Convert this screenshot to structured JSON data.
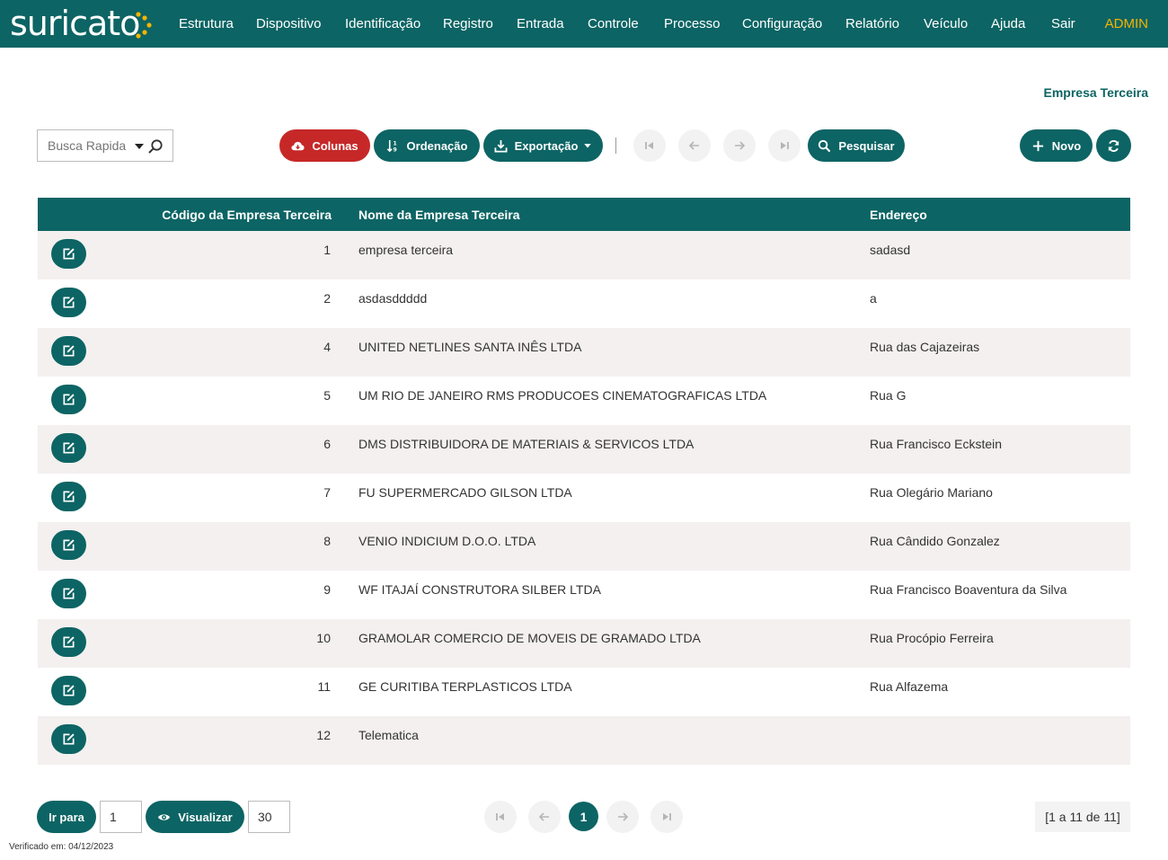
{
  "app": {
    "logo": "suricato"
  },
  "nav": {
    "items": [
      "Estrutura",
      "Dispositivo",
      "Identificação",
      "Registro",
      "Entrada",
      "Controle",
      "Processo",
      "Configuração",
      "Relatório",
      "Veículo",
      "Ajuda",
      "Sair"
    ],
    "user": "ADMIN"
  },
  "page": {
    "title": "Empresa Terceira"
  },
  "toolbar": {
    "quick_search_placeholder": "Busca Rapida",
    "columns": "Colunas",
    "sort": "Ordenação",
    "export": "Exportação",
    "search": "Pesquisar",
    "new": "Novo"
  },
  "table": {
    "headers": [
      "Código da Empresa Terceira",
      "Nome da Empresa Terceira",
      "Endereço"
    ],
    "rows": [
      {
        "code": "1",
        "name": "empresa terceira",
        "address": "sadasd"
      },
      {
        "code": "2",
        "name": "asdasddddd",
        "address": "a"
      },
      {
        "code": "4",
        "name": "UNITED NETLINES SANTA INÊS LTDA",
        "address": "Rua das Cajazeiras"
      },
      {
        "code": "5",
        "name": "UM RIO DE JANEIRO RMS PRODUCOES CINEMATOGRAFICAS LTDA",
        "address": "Rua G"
      },
      {
        "code": "6",
        "name": "DMS DISTRIBUIDORA DE MATERIAIS & SERVICOS LTDA",
        "address": "Rua Francisco Eckstein"
      },
      {
        "code": "7",
        "name": "FU SUPERMERCADO GILSON LTDA",
        "address": "Rua Olegário Mariano"
      },
      {
        "code": "8",
        "name": "VENIO INDICIUM D.O.O. LTDA",
        "address": "Rua Cândido Gonzalez"
      },
      {
        "code": "9",
        "name": "WF ITAJAÍ CONSTRUTORA SILBER LTDA",
        "address": "Rua Francisco Boaventura da Silva"
      },
      {
        "code": "10",
        "name": "GRAMOLAR COMERCIO DE MOVEIS DE GRAMADO LTDA",
        "address": "Rua Procópio Ferreira"
      },
      {
        "code": "11",
        "name": "GE CURITIBA TERPLASTICOS LTDA",
        "address": "Rua Alfazema"
      },
      {
        "code": "12",
        "name": "Telematica",
        "address": ""
      }
    ]
  },
  "footer": {
    "goto_label": "Ir para",
    "goto_value": "1",
    "view_label": "Visualizar",
    "view_value": "30",
    "current_page": "1",
    "range": "[1 a 11 de 11]",
    "verified": "Verificado em: 04/12/2023"
  },
  "colors": {
    "primary": "#0d6464",
    "danger": "#c62828",
    "admin": "#f5b400"
  }
}
